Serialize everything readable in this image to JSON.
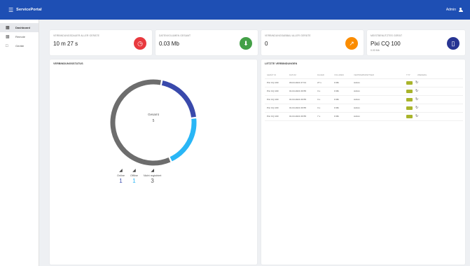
{
  "appbar": {
    "title": "ServicePortal",
    "user": "Admin"
  },
  "sidebar": {
    "items": [
      {
        "label": "Dashboard",
        "icon": "dashboard-icon"
      },
      {
        "label": "Remote",
        "icon": "remote-icon"
      },
      {
        "label": "Geräte",
        "icon": "devices-icon"
      }
    ]
  },
  "stats": [
    {
      "label": "VERBINDUNGSDAUER ALLER GERÄTE",
      "value": "10 m 27 s",
      "icon": "timer-icon",
      "color": "#e8393e"
    },
    {
      "label": "DATENVOLUMEN GESAMT",
      "value": "0.03 Mb",
      "icon": "download-icon",
      "color": "#43a047"
    },
    {
      "label": "VERBINDUNGSABBAU ALLER GERÄTE",
      "value": "0",
      "icon": "trend-icon",
      "color": "#fb8c00"
    },
    {
      "label": "MEISTBENUTZTES GERÄT",
      "value": "Pixi CQ 100",
      "sub": "0.03 Mb",
      "icon": "device-icon",
      "color": "#283593"
    }
  ],
  "status_panel": {
    "title": "VERBINDUNGSSTATUS",
    "center_label": "Gesamt",
    "center_value": "5",
    "legend": [
      {
        "label": "Online",
        "value": "1",
        "color": "#3949ab"
      },
      {
        "label": "Offline",
        "value": "1",
        "color": "#29b6f6"
      },
      {
        "label": "Nicht registriert",
        "value": "3",
        "color": "#6d6d6d"
      }
    ]
  },
  "chart_data": {
    "type": "pie",
    "title": "",
    "center_label": "Gesamt",
    "total": 5,
    "slices": [
      {
        "label": "Online",
        "value": 1,
        "color": "#3949ab"
      },
      {
        "label": "Offline",
        "value": 1,
        "color": "#29b6f6"
      },
      {
        "label": "Nicht registriert",
        "value": 3,
        "color": "#6d6d6d"
      }
    ]
  },
  "connections": {
    "title": "LETZTE VERBINDUNGEN",
    "columns": [
      "GERÄT ID",
      "DATUM",
      "DAUER",
      "VOLUMEN",
      "VERTRIEBSPARTNER",
      "TYP",
      "WIEDERH."
    ],
    "rows": [
      {
        "device": "Pixi CQ 100",
        "date": "06.04.2021 07:01",
        "duration": "27 s",
        "volume": "0 Mb",
        "partner": "Admin"
      },
      {
        "device": "Pixi CQ 100",
        "date": "01.04.2021 09:55",
        "duration": "3 s",
        "volume": "0 Mb",
        "partner": "Admin"
      },
      {
        "device": "Pixi CQ 100",
        "date": "01.04.2021 09:55",
        "duration": "3 s",
        "volume": "0 Mb",
        "partner": "Admin"
      },
      {
        "device": "Pixi CQ 100",
        "date": "01.04.2021 09:55",
        "duration": "3 s",
        "volume": "0 Mb",
        "partner": "Admin"
      },
      {
        "device": "Pixi CQ 100",
        "date": "01.04.2021 09:55",
        "duration": "7 s",
        "volume": "0 Mb",
        "partner": "Admin"
      }
    ]
  }
}
